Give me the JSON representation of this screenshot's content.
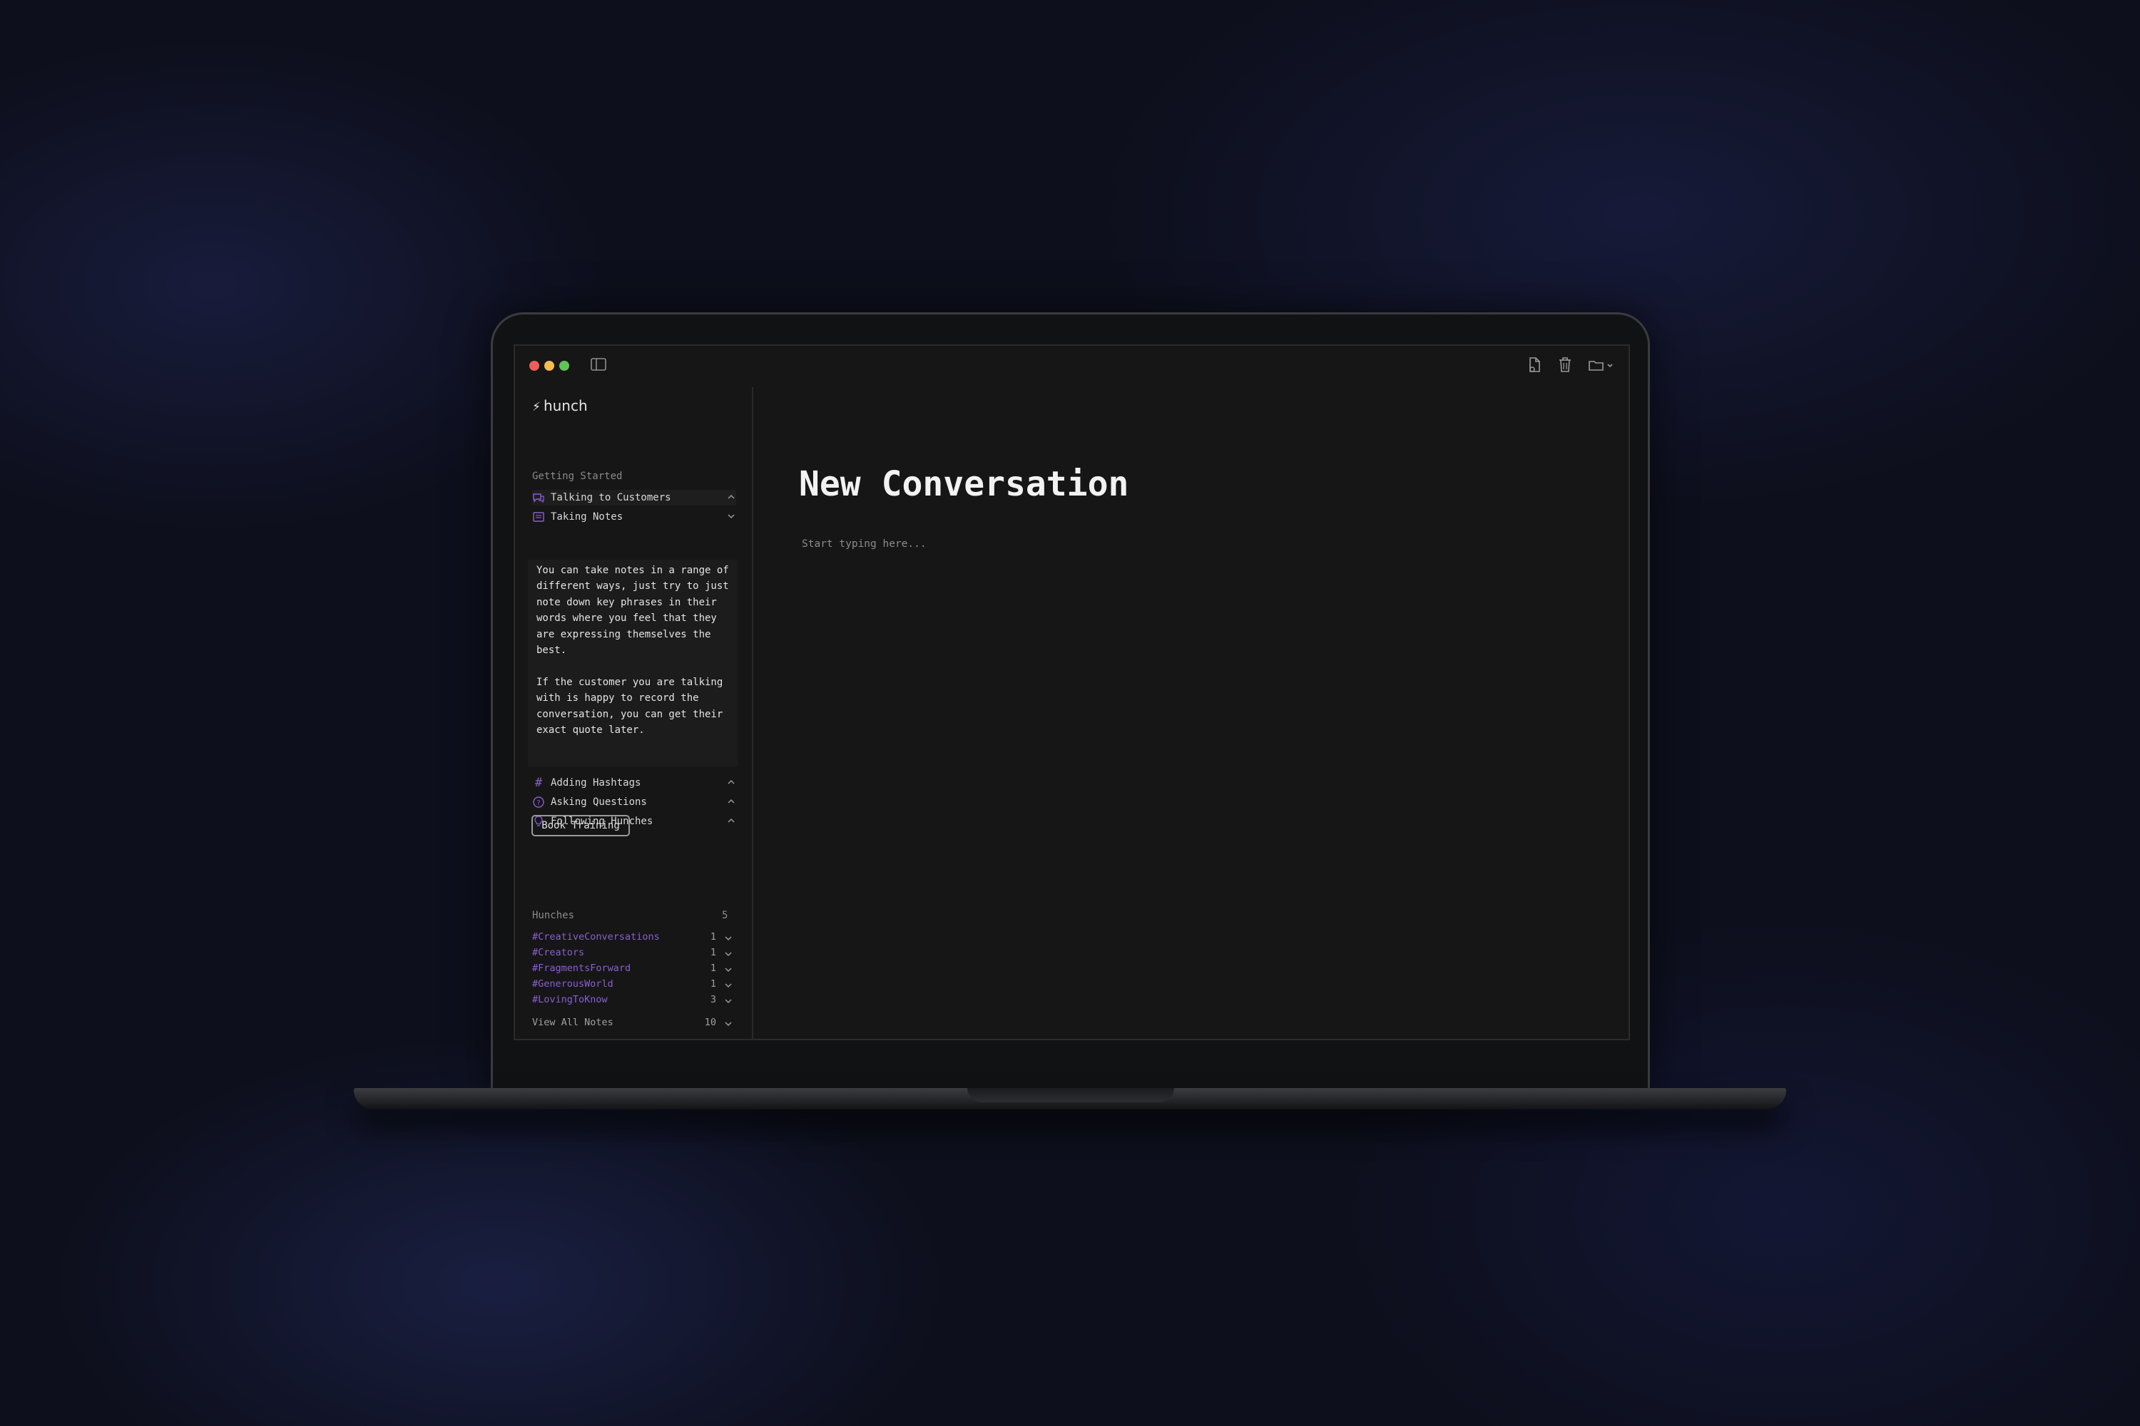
{
  "app": {
    "name": "hunch"
  },
  "sidebar": {
    "getting_started_label": "Getting Started",
    "items": [
      {
        "label": "Talking to Customers",
        "icon": "chat-bubbles-icon",
        "state": "collapsed"
      },
      {
        "label": "Taking Notes",
        "icon": "notebook-icon",
        "state": "expanded"
      },
      {
        "label": "Adding Hashtags",
        "icon": "hashtag-icon",
        "state": "collapsed"
      },
      {
        "label": "Asking Questions",
        "icon": "question-circle-icon",
        "state": "collapsed"
      },
      {
        "label": "Following Hunches",
        "icon": "lightbulb-icon",
        "state": "collapsed"
      }
    ],
    "expanded_text": "You can take notes in a range of different ways, just try to just note down key phrases in their words where you feel that they are expressing themselves the best.\n\nIf the customer you are talking with is happy to record the conversation, you can get their exact quote later.",
    "book_button": "Book Training",
    "hunches_label": "Hunches",
    "hunches_count": "5",
    "hunches": [
      {
        "tag": "#CreativeConversations",
        "count": "1"
      },
      {
        "tag": "#Creators",
        "count": "1"
      },
      {
        "tag": "#FragmentsForward",
        "count": "1"
      },
      {
        "tag": "#GenerousWorld",
        "count": "1"
      },
      {
        "tag": "#LovingToKnow",
        "count": "3"
      }
    ],
    "view_all_label": "View All Notes",
    "view_all_count": "10"
  },
  "main": {
    "title": "New Conversation",
    "placeholder": "Start typing here..."
  },
  "colors": {
    "accent": "#8a5fd0",
    "window_bg": "#161616",
    "traffic_red": "#ec5f56",
    "traffic_yellow": "#f4bd4f",
    "traffic_green": "#5fc454"
  }
}
